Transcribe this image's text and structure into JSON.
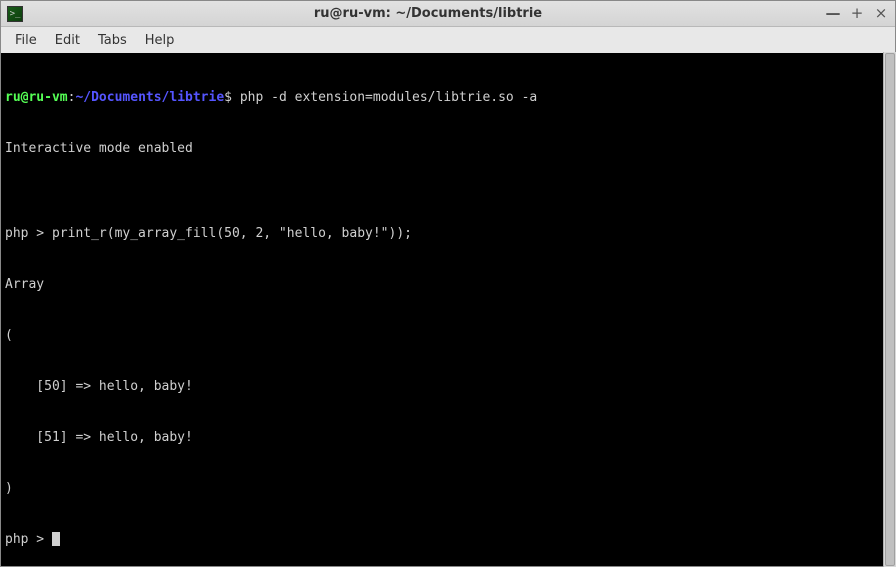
{
  "titlebar": {
    "title": "ru@ru-vm: ~/Documents/libtrie"
  },
  "menubar": {
    "items": [
      {
        "label": "File"
      },
      {
        "label": "Edit"
      },
      {
        "label": "Tabs"
      },
      {
        "label": "Help"
      }
    ]
  },
  "terminal": {
    "prompt": {
      "user_host": "ru@ru-vm",
      "separator": ":",
      "path": "~/Documents/libtrie",
      "symbol": "$"
    },
    "lines": [
      {
        "type": "cmd",
        "command": "php -d extension=modules/libtrie.so -a"
      },
      {
        "type": "out",
        "text": "Interactive mode enabled"
      },
      {
        "type": "out",
        "text": ""
      },
      {
        "type": "out",
        "text": "php > print_r(my_array_fill(50, 2, \"hello, baby!\"));"
      },
      {
        "type": "out",
        "text": "Array"
      },
      {
        "type": "out",
        "text": "("
      },
      {
        "type": "out",
        "text": "    [50] => hello, baby!"
      },
      {
        "type": "out",
        "text": "    [51] => hello, baby!"
      },
      {
        "type": "out",
        "text": ")"
      },
      {
        "type": "out",
        "text": "php > "
      }
    ]
  }
}
